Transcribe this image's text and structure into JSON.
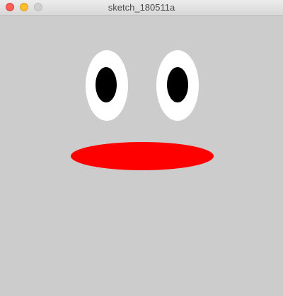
{
  "window": {
    "title": "sketch_180511a",
    "controls": {
      "close_color": "#fd5f57",
      "minimize_color": "#febc2e",
      "zoom_color": "#cfcfcf"
    }
  },
  "canvas": {
    "background_color": "#cccccc",
    "shapes": {
      "eye_white_color": "#ffffff",
      "pupil_color": "#000000",
      "mouth_color": "#ff0000"
    }
  }
}
